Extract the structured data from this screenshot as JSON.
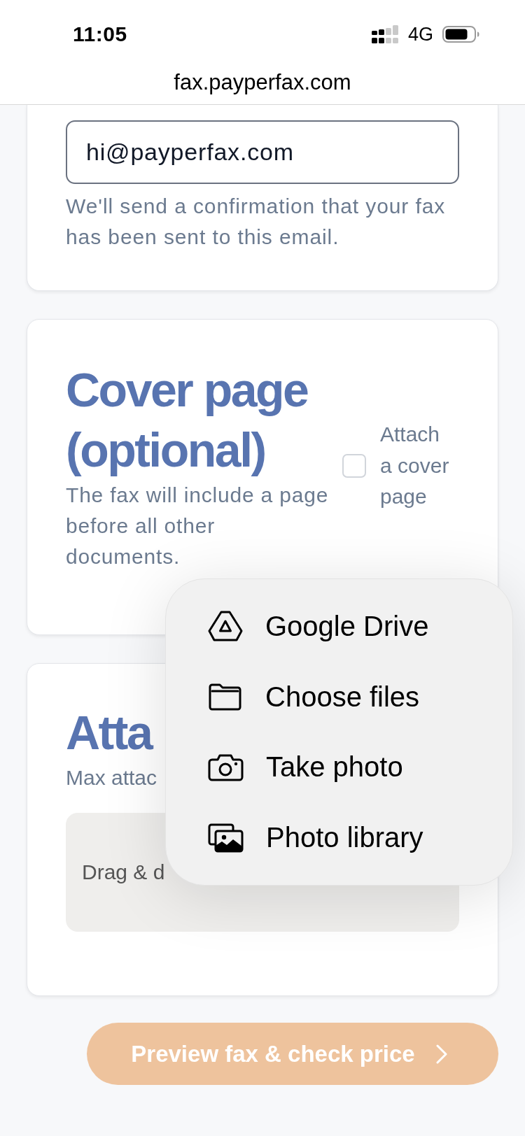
{
  "status_bar": {
    "time": "11:05",
    "network": "4G"
  },
  "browser": {
    "url": "fax.payperfax.com"
  },
  "email_section": {
    "email_field": {
      "value": "hi@payperfax.com"
    },
    "hint": "We'll send a confirmation that your fax has been sent to this email."
  },
  "cover_page_section": {
    "title": "Cover page (optional)",
    "description": "The fax will include a page before all other documents.",
    "checkbox": {
      "label": "Attach a cover page",
      "checked": false
    }
  },
  "attachments_section": {
    "title": "Atta",
    "subtitle": "Max attac",
    "drop_zone": {
      "text": "Drag & d"
    }
  },
  "upload_menu": {
    "items": [
      {
        "kind": "drive",
        "label": "Google Drive"
      },
      {
        "kind": "folder",
        "label": "Choose files"
      },
      {
        "kind": "camera",
        "label": "Take photo"
      },
      {
        "kind": "photos",
        "label": "Photo library"
      }
    ]
  },
  "preview_button": {
    "label": "Preview fax & check price"
  }
}
